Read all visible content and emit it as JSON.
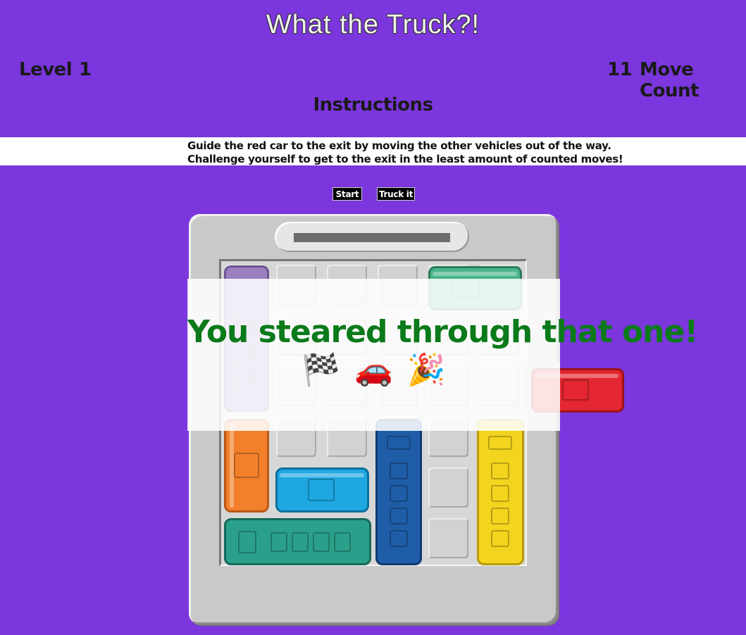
{
  "header": {
    "title": "What the Truck?!",
    "level_label": "Level",
    "level_value": "1",
    "move_count_value": "11",
    "move_count_label": "Move Count",
    "instructions_heading": "Instructions"
  },
  "instructions": {
    "line1": "Guide the red car to the exit by moving the other vehicles out of the way.",
    "line2": "Challenge yourself to get to the exit in the least amount of counted moves!"
  },
  "controls": {
    "start_label": "Start",
    "truck_it_label": "Truck it"
  },
  "overlay": {
    "message": "You steared through that one!",
    "emojis": [
      "🏁",
      "🚗",
      "🎉"
    ]
  },
  "vehicles": [
    {
      "name": "purple-truck",
      "orientation": "vertical",
      "color": "#9c7fbf"
    },
    {
      "name": "green-car",
      "orientation": "horizontal",
      "color": "#49b68a"
    },
    {
      "name": "red-car",
      "orientation": "horizontal",
      "color": "#e32631"
    },
    {
      "name": "orange-car",
      "orientation": "vertical",
      "color": "#f27f2a"
    },
    {
      "name": "blue-car",
      "orientation": "horizontal",
      "color": "#1ea7e1"
    },
    {
      "name": "navy-truck",
      "orientation": "vertical",
      "color": "#1f5da8"
    },
    {
      "name": "yellow-truck",
      "orientation": "vertical",
      "color": "#f3d41e"
    },
    {
      "name": "teal-truck",
      "orientation": "horizontal",
      "color": "#2aa08a"
    }
  ],
  "colors": {
    "background": "#7b36dd",
    "board": "#c9c9c9",
    "win_text": "#0b7a1a"
  }
}
